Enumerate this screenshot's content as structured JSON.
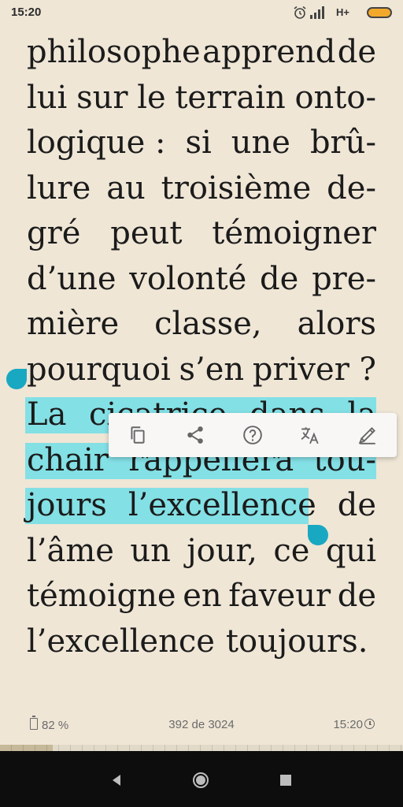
{
  "status_bar": {
    "time": "15:20",
    "network": "H+",
    "icons": [
      "alarm-icon",
      "signal-icon",
      "battery-icon"
    ],
    "battery_color": "#f2a92b"
  },
  "reader": {
    "lines": [
      [
        "philosophe",
        "apprend",
        "de"
      ],
      [
        "lui",
        "sur",
        "le",
        "terrain",
        "onto-"
      ],
      [
        "logique :",
        "si",
        "une",
        "brû-"
      ],
      [
        "lure",
        "au",
        "troisième",
        "de-"
      ],
      [
        "gré",
        "peut",
        "témoigner"
      ],
      [
        "d’une",
        "volonté",
        "de",
        "pre-"
      ],
      [
        "mière",
        "classe,",
        "alors"
      ],
      [
        "pourquoi",
        "s’en",
        "priver ?"
      ],
      [
        "La",
        "cicatrice",
        "dans",
        "la"
      ],
      [
        "chair",
        "rappellera",
        "tou-"
      ],
      [
        "jours",
        "l’excellence",
        "de"
      ],
      [
        "l’âme",
        "un",
        "jour,",
        "ce",
        "qui"
      ],
      [
        "témoigne",
        "en",
        "faveur",
        "de"
      ],
      [
        "l’excellence",
        "toujours."
      ]
    ],
    "highlight_color": "#83e0e5",
    "handle_color": "#19a8c2"
  },
  "selection_toolbar": {
    "buttons": [
      "copy-icon",
      "share-icon",
      "help-icon",
      "translate-icon",
      "highlight-pen-icon"
    ]
  },
  "footer": {
    "battery": "82 %",
    "pages": "392 de 3024",
    "time": "15:20"
  },
  "progress": {
    "fraction": 0.13
  },
  "nav_bar": {
    "buttons": [
      "back-icon",
      "home-icon",
      "recents-icon"
    ]
  }
}
